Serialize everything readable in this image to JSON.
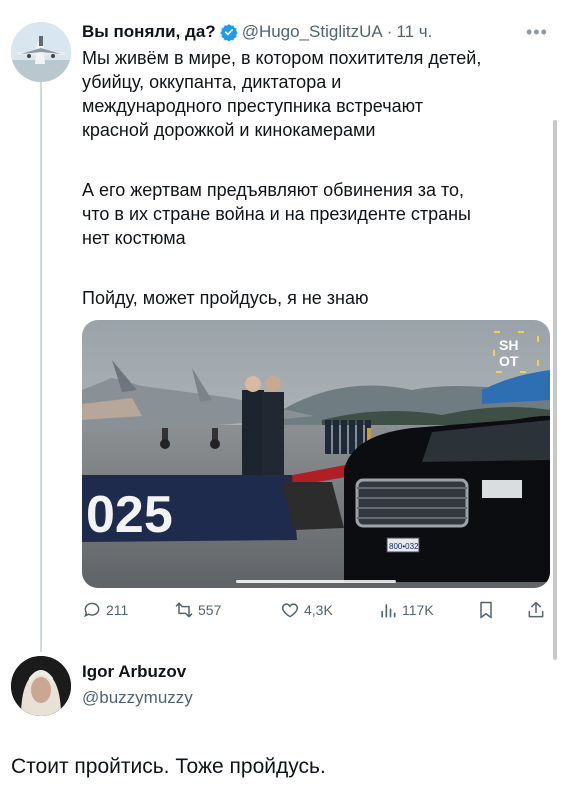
{
  "tweet": {
    "author_name": "Вы поняли, да?",
    "author_handle": "@Hugo_StiglitzUA",
    "separator": "·",
    "time": "11 ч.",
    "more_icon": "more-horizontal-icon",
    "paragraphs": [
      [
        "Мы живём в мире, в котором похитителя детей,",
        "убийцу, оккупанта, диктатора и",
        "международного преступника встречают",
        "красной дорожкой и кинокамерами"
      ],
      [
        "А его жертвам предъявляют обвинения за то,",
        "что в их стране война и на президенте страны",
        "нет костюма"
      ],
      [
        "Пойду, может пройдусь, я не знаю"
      ]
    ],
    "media": {
      "watermark": "SHOT",
      "banner_text": "025",
      "plate_text": "800•032"
    },
    "actions": {
      "replies": "211",
      "retweets": "557",
      "likes": "4,3K",
      "views": "117K"
    },
    "colors": {
      "verified": "#1d9bf0",
      "handle": "#536471",
      "text": "#0f1419"
    }
  },
  "reply": {
    "author_name": "Igor Arbuzov",
    "author_handle": "@buzzymuzzy",
    "text": "Стоит пройтись. Тоже пройдусь."
  }
}
